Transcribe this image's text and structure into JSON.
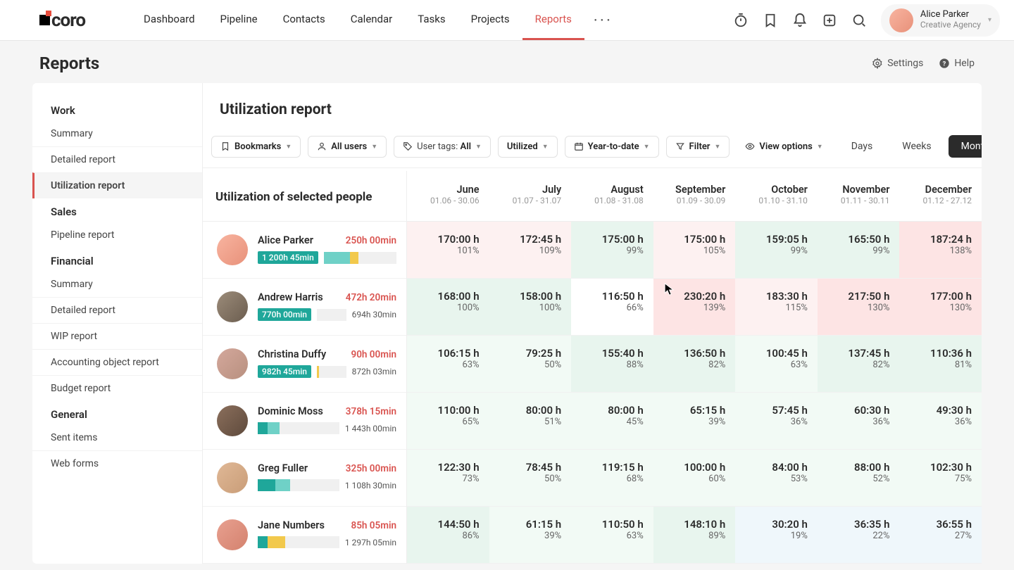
{
  "logo_text": "coro",
  "nav": [
    "Dashboard",
    "Pipeline",
    "Contacts",
    "Calendar",
    "Tasks",
    "Projects",
    "Reports"
  ],
  "nav_active_index": 6,
  "user": {
    "name": "Alice Parker",
    "sub": "Creative Agency"
  },
  "page": {
    "title": "Reports",
    "settings": "Settings",
    "help": "Help"
  },
  "sidebar": {
    "groups": [
      {
        "label": "Work",
        "items": [
          "Summary",
          "Detailed report",
          "Utilization report"
        ],
        "active_index": 2
      },
      {
        "label": "Sales",
        "items": [
          "Pipeline report"
        ],
        "active_index": -1
      },
      {
        "label": "Financial",
        "items": [
          "Summary",
          "Detailed report",
          "WIP report",
          "Accounting object report",
          "Budget report"
        ],
        "active_index": -1
      },
      {
        "label": "General",
        "items": [
          "Sent items",
          "Web forms"
        ],
        "active_index": -1
      }
    ]
  },
  "content_title": "Utilization report",
  "filters": {
    "bookmarks": "Bookmarks",
    "all_users": "All users",
    "tags_label": "User tags: ",
    "tags_value": "All",
    "utilized": "Utilized",
    "ytd": "Year-to-date",
    "filter": "Filter",
    "view": "View options"
  },
  "seg": {
    "days": "Days",
    "weeks": "Weeks",
    "months": "Months",
    "active": "Months"
  },
  "people_head": "Utilization of selected people",
  "months": [
    {
      "name": "June",
      "range": "01.06 - 30.06"
    },
    {
      "name": "July",
      "range": "01.07 - 31.07"
    },
    {
      "name": "August",
      "range": "01.08 - 31.08"
    },
    {
      "name": "September",
      "range": "01.09 - 30.09"
    },
    {
      "name": "October",
      "range": "01.10 - 31.10"
    },
    {
      "name": "November",
      "range": "01.11 - 30.11"
    },
    {
      "name": "December",
      "range": "01.12 - 27.12"
    }
  ],
  "people": [
    {
      "name": "Alice Parker",
      "total": "250h 00min",
      "avatar_bg": "linear-gradient(135deg,#f8b4a0,#e8917a)",
      "badge": "1 200h 45min",
      "bar": [
        58,
        18,
        6
      ],
      "side": "",
      "cells": [
        {
          "h": "170:00 h",
          "p": "101%",
          "bg": "bg-pink-l"
        },
        {
          "h": "172:45 h",
          "p": "109%",
          "bg": "bg-pink-l"
        },
        {
          "h": "175:00 h",
          "p": "99%",
          "bg": "bg-green"
        },
        {
          "h": "175:00 h",
          "p": "105%",
          "bg": "bg-pink-l"
        },
        {
          "h": "159:05 h",
          "p": "99%",
          "bg": "bg-green"
        },
        {
          "h": "165:50 h",
          "p": "99%",
          "bg": "bg-green"
        },
        {
          "h": "187:24 h",
          "p": "138%",
          "bg": "bg-pink"
        }
      ]
    },
    {
      "name": "Andrew Harris",
      "total": "472h 20min",
      "avatar_bg": "linear-gradient(135deg,#9c8c7a,#6b5d4f)",
      "badge": "770h 00min",
      "bar": [
        40,
        0,
        0
      ],
      "side": "694h 30min",
      "cells": [
        {
          "h": "168:00 h",
          "p": "100%",
          "bg": "bg-green"
        },
        {
          "h": "158:00 h",
          "p": "100%",
          "bg": "bg-green"
        },
        {
          "h": "116:50 h",
          "p": "66%",
          "bg": ""
        },
        {
          "h": "230:20 h",
          "p": "139%",
          "bg": "bg-pink",
          "cursor": true
        },
        {
          "h": "183:30 h",
          "p": "115%",
          "bg": "bg-pink-l"
        },
        {
          "h": "217:50 h",
          "p": "130%",
          "bg": "bg-pink"
        },
        {
          "h": "177:00 h",
          "p": "130%",
          "bg": "bg-pink"
        }
      ]
    },
    {
      "name": "Christina Duffy",
      "total": "90h 00min",
      "avatar_bg": "linear-gradient(135deg,#d4a89c,#b8907f)",
      "badge": "982h 45min",
      "bar": [
        50,
        0,
        4
      ],
      "side": "872h 03min",
      "cells": [
        {
          "h": "106:15 h",
          "p": "63%",
          "bg": "bg-green-l"
        },
        {
          "h": "79:25 h",
          "p": "50%",
          "bg": "bg-green-l"
        },
        {
          "h": "155:40 h",
          "p": "88%",
          "bg": "bg-green"
        },
        {
          "h": "136:50 h",
          "p": "82%",
          "bg": "bg-green"
        },
        {
          "h": "100:45 h",
          "p": "63%",
          "bg": "bg-green-l"
        },
        {
          "h": "137:45 h",
          "p": "82%",
          "bg": "bg-green"
        },
        {
          "h": "110:36 h",
          "p": "81%",
          "bg": "bg-green"
        }
      ]
    },
    {
      "name": "Dominic Moss",
      "total": "378h 15min",
      "avatar_bg": "linear-gradient(135deg,#8b6f5c,#5e4a3c)",
      "badge": "",
      "bar": [
        12,
        15,
        0
      ],
      "side": "1 443h 00min",
      "cells": [
        {
          "h": "110:00 h",
          "p": "65%",
          "bg": "bg-green-l"
        },
        {
          "h": "80:00 h",
          "p": "51%",
          "bg": "bg-green-l"
        },
        {
          "h": "80:00 h",
          "p": "45%",
          "bg": "bg-green-l"
        },
        {
          "h": "65:15 h",
          "p": "39%",
          "bg": "bg-green-l"
        },
        {
          "h": "57:45 h",
          "p": "36%",
          "bg": "bg-green-l"
        },
        {
          "h": "60:30 h",
          "p": "36%",
          "bg": "bg-green-l"
        },
        {
          "h": "49:30 h",
          "p": "36%",
          "bg": "bg-green-l"
        }
      ]
    },
    {
      "name": "Greg Fuller",
      "total": "325h 00min",
      "avatar_bg": "linear-gradient(135deg,#e0b896,#c99d78)",
      "badge": "",
      "bar": [
        22,
        18,
        0
      ],
      "side": "1 108h 30min",
      "cells": [
        {
          "h": "122:30 h",
          "p": "73%",
          "bg": "bg-green-l"
        },
        {
          "h": "78:45 h",
          "p": "50%",
          "bg": "bg-green-l"
        },
        {
          "h": "119:15 h",
          "p": "68%",
          "bg": "bg-green-l"
        },
        {
          "h": "100:00 h",
          "p": "60%",
          "bg": "bg-green-l"
        },
        {
          "h": "84:00 h",
          "p": "53%",
          "bg": "bg-green-l"
        },
        {
          "h": "88:00 h",
          "p": "52%",
          "bg": "bg-green-l"
        },
        {
          "h": "102:30 h",
          "p": "75%",
          "bg": "bg-green-l"
        }
      ]
    },
    {
      "name": "Jane Numbers",
      "total": "85h 05min",
      "avatar_bg": "linear-gradient(135deg,#e8a090,#d4826e)",
      "badge": "",
      "bar": [
        12,
        0,
        22
      ],
      "side": "1 297h 05min",
      "cells": [
        {
          "h": "144:50 h",
          "p": "86%",
          "bg": "bg-green"
        },
        {
          "h": "61:15 h",
          "p": "39%",
          "bg": "bg-green-l"
        },
        {
          "h": "110:50 h",
          "p": "63%",
          "bg": "bg-green-l"
        },
        {
          "h": "148:10 h",
          "p": "89%",
          "bg": "bg-green"
        },
        {
          "h": "30:20 h",
          "p": "19%",
          "bg": "bg-blue-l"
        },
        {
          "h": "36:35 h",
          "p": "22%",
          "bg": "bg-blue-l"
        },
        {
          "h": "36:55 h",
          "p": "27%",
          "bg": "bg-blue-l"
        }
      ]
    }
  ]
}
